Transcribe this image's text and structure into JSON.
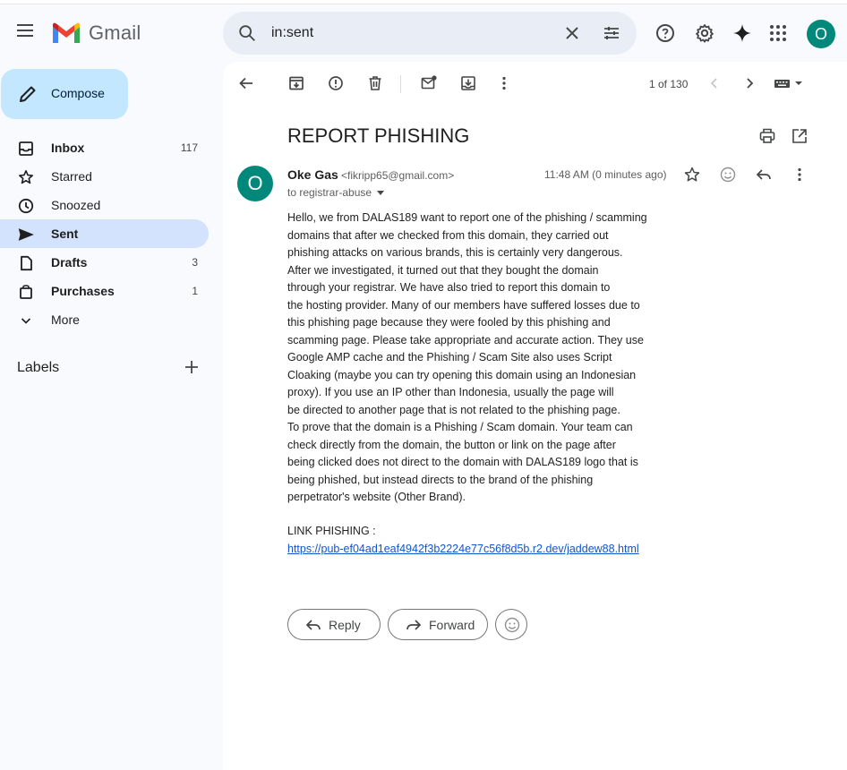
{
  "app": {
    "name": "Gmail"
  },
  "search": {
    "value": "in:sent"
  },
  "account": {
    "initial": "O"
  },
  "sidebar": {
    "compose_label": "Compose",
    "items": [
      {
        "label": "Inbox",
        "count": "117",
        "icon": "inbox-icon",
        "bold": true
      },
      {
        "label": "Starred",
        "count": "",
        "icon": "star-icon",
        "bold": false
      },
      {
        "label": "Snoozed",
        "count": "",
        "icon": "clock-icon",
        "bold": false
      },
      {
        "label": "Sent",
        "count": "",
        "icon": "send-icon",
        "bold": true,
        "active": true
      },
      {
        "label": "Drafts",
        "count": "3",
        "icon": "draft-icon",
        "bold": true
      },
      {
        "label": "Purchases",
        "count": "1",
        "icon": "shopping-bag-icon",
        "bold": true
      },
      {
        "label": "More",
        "count": "",
        "icon": "chevron-down-icon",
        "bold": false
      }
    ],
    "labels_title": "Labels"
  },
  "toolbar": {
    "pagination": "1 of 130"
  },
  "email": {
    "subject": "REPORT PHISHING",
    "sender_initial": "O",
    "sender_name": "Oke Gas",
    "sender_email": "<fikripp65@gmail.com>",
    "recipient": "to registrar-abuse",
    "time": "11:48 AM (0 minutes ago)",
    "body_lines": [
      "Hello, we from DALAS189  want to report one of the phishing / scamming",
      "domains that after we checked from this domain, they carried out",
      "phishing attacks on various brands, this is certainly very dangerous.",
      "After we investigated, it turned out that they bought the domain",
      "through your registrar. We have also tried to report this domain to",
      "the hosting provider. Many of our members have suffered losses due to",
      "this phishing page because they were fooled by this phishing and",
      "scamming page. Please take appropriate and accurate action. They use",
      "Google AMP cache and the Phishing / Scam Site also uses Script",
      "Cloaking (maybe you can try opening this domain using an Indonesian",
      "proxy). If you use an IP other than Indonesia, usually the page will",
      "be directed to another page that is not related to the phishing page.",
      "To prove that the domain is a Phishing / Scam domain. Your team can",
      "check directly from the domain, the button or link on the page after",
      "being clicked does not direct to the domain with DALAS189 logo that is",
      "being phished, but instead directs to the brand of the phishing",
      "perpetrator's website (Other Brand)."
    ],
    "link_label": "LINK PHISHING :",
    "link_url": "https://pub-ef04ad1eaf4942f3b2224e77c56f8d5b.r2.dev/jaddew88.html"
  },
  "actions": {
    "reply_label": "Reply",
    "forward_label": "Forward"
  },
  "colors": {
    "accent": "#c2e7ff",
    "active_nav": "#d3e3fd",
    "avatar": "#00897b",
    "link": "#1155cc"
  }
}
